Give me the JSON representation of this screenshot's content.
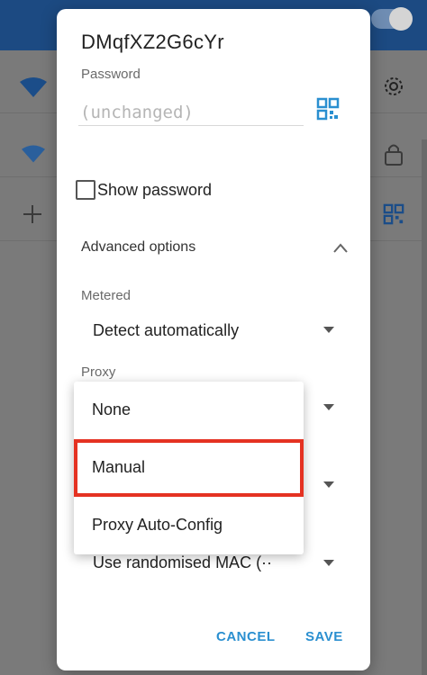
{
  "dialog": {
    "ssid": "DMqfXZ2G6cYr",
    "password_label": "Password",
    "password_placeholder": "(unchanged)",
    "show_password_label": "Show password",
    "show_password_checked": false,
    "advanced_options_label": "Advanced options",
    "metered_label": "Metered",
    "metered_value": "Detect automatically",
    "proxy_label": "Proxy",
    "privacy_value": "Use randomised MAC (··",
    "cancel_label": "CANCEL",
    "save_label": "SAVE"
  },
  "proxy_menu": {
    "options": [
      "None",
      "Manual",
      "Proxy Auto-Config"
    ],
    "highlighted": "Manual"
  },
  "icons": {
    "wifi": "wifi-icon",
    "settings": "gear-icon",
    "lock": "lock-icon",
    "add": "add-icon",
    "qr": "qr-code-icon"
  },
  "colors": {
    "accent": "#2a8fd0",
    "highlight": "#e53222",
    "appbar": "#1c4a82"
  }
}
